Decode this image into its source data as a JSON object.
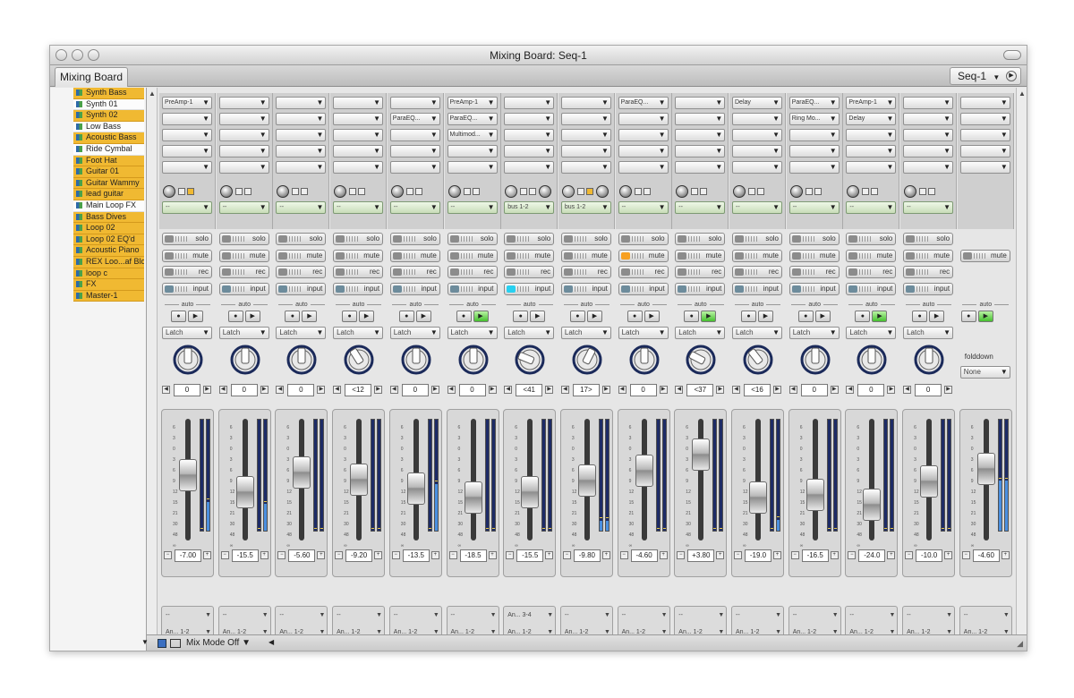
{
  "window": {
    "title": "Mixing Board: Seq-1",
    "tab": "Mixing Board",
    "sequence": "Seq-1"
  },
  "tracklist": [
    {
      "name": "Synth Bass",
      "selected": false
    },
    {
      "name": "Synth 01",
      "selected": true
    },
    {
      "name": "Synth 02",
      "selected": false
    },
    {
      "name": "Low Bass",
      "selected": true
    },
    {
      "name": "Acoustic Bass",
      "selected": false
    },
    {
      "name": "Ride Cymbal",
      "selected": true
    },
    {
      "name": "Foot Hat",
      "selected": false
    },
    {
      "name": "Guitar 01",
      "selected": false
    },
    {
      "name": "Guitar Wammy",
      "selected": false
    },
    {
      "name": "lead guitar",
      "selected": false
    },
    {
      "name": "Main Loop FX",
      "selected": true
    },
    {
      "name": "Bass Dives",
      "selected": false
    },
    {
      "name": "Loop 02",
      "selected": false
    },
    {
      "name": "Loop 02 EQ'd",
      "selected": false
    },
    {
      "name": "Acoustic Piano",
      "selected": false
    },
    {
      "name": "REX Loo...af Blower",
      "selected": false
    },
    {
      "name": "loop c",
      "selected": false
    },
    {
      "name": "FX",
      "selected": false
    },
    {
      "name": "Master-1",
      "selected": false
    }
  ],
  "labels": {
    "solo": "solo",
    "mute": "mute",
    "rec": "rec",
    "input": "input",
    "auto": "auto",
    "latch": "Latch",
    "folddown": "folddown",
    "none": "None",
    "mix_mode": "Mix Mode Off",
    "dash": "--",
    "dash_small": "--",
    "stop": "●",
    "play": "▶",
    "minus": "−",
    "plus": "+",
    "dd": "▼"
  },
  "channels": [
    {
      "name": "Synth Bass",
      "color": "#8e4f8f",
      "inserts": [
        "PreAmp-1",
        "",
        "",
        "",
        ""
      ],
      "bus": "",
      "pan_text": "0",
      "pan_pct": 0.5,
      "fader_text": "-7.00",
      "fader_pct": 0.55,
      "meter_pct": [
        0,
        0.26
      ],
      "out1": "--",
      "out2": "An... 1-2",
      "auto_on": false,
      "bus_type": "knob"
    },
    {
      "name": "Synth 02",
      "color": "#2e6e91",
      "inserts": [
        "",
        "",
        "",
        "",
        ""
      ],
      "bus": "",
      "pan_text": "0",
      "pan_pct": 0.5,
      "fader_text": "-15.5",
      "fader_pct": 0.36,
      "meter_pct": [
        0,
        0.24
      ],
      "out1": "--",
      "out2": "An... 1-2",
      "auto_on": false,
      "bus_type": "knob"
    },
    {
      "name": "Acoustic Bass",
      "color": "#2f8a8a",
      "inserts": [
        "",
        "",
        "",
        "",
        ""
      ],
      "bus": "",
      "pan_text": "0",
      "pan_pct": 0.5,
      "fader_text": "-5.60",
      "fader_pct": 0.58,
      "meter_pct": [
        0,
        0
      ],
      "out1": "--",
      "out2": "An... 1-2",
      "auto_on": false,
      "bus_type": "knob"
    },
    {
      "name": "Foot Hat",
      "color": "#555a8f",
      "inserts": [
        "",
        "",
        "",
        "",
        ""
      ],
      "bus": "",
      "pan_text": "<12",
      "pan_pct": 0.38,
      "fader_text": "-9.20",
      "fader_pct": 0.5,
      "meter_pct": [
        0,
        0
      ],
      "out1": "--",
      "out2": "An... 1-2",
      "auto_on": false,
      "bus_type": "knob"
    },
    {
      "name": "Guitar 01",
      "color": "#3e7b97",
      "inserts": [
        "",
        "ParaEQ...",
        "",
        "",
        ""
      ],
      "bus": "",
      "pan_text": "0",
      "pan_pct": 0.5,
      "fader_text": "-13.5",
      "fader_pct": 0.4,
      "meter_pct": [
        0,
        0.42
      ],
      "out1": "--",
      "out2": "An... 1-2",
      "auto_on": false,
      "bus_type": "knob"
    },
    {
      "name": "Guitar Wammy",
      "color": "#c0823e",
      "inserts": [
        "PreAmp-1",
        "ParaEQ...",
        "Multimod...",
        "",
        ""
      ],
      "bus": "",
      "pan_text": "0",
      "pan_pct": 0.5,
      "fader_text": "-18.5",
      "fader_pct": 0.3,
      "meter_pct": [
        0,
        0
      ],
      "out1": "--",
      "out2": "An... 1-2",
      "auto_on": true,
      "bus_type": "knob"
    },
    {
      "name": "lead guitar",
      "color": "#5c8a3c",
      "inserts": [
        "",
        "",
        "",
        "",
        ""
      ],
      "bus": "bus 1-2",
      "pan_text": "<41",
      "pan_pct": 0.25,
      "fader_text": "-15.5",
      "fader_pct": 0.36,
      "meter_pct": [
        0,
        0
      ],
      "out1": "An... 3-4",
      "out2": "An... 1-2",
      "auto_on": false,
      "bus_type": "send"
    },
    {
      "name": "Bass Dives",
      "color": "#7f7f7f",
      "inserts": [
        "",
        "",
        "",
        "",
        ""
      ],
      "bus": "bus 1-2",
      "pan_text": "17>",
      "pan_pct": 0.6,
      "fader_text": "-9.80",
      "fader_pct": 0.49,
      "meter_pct": [
        0.09,
        0.09
      ],
      "out1": "--",
      "out2": "An... 1-2",
      "auto_on": false,
      "bus_type": "send"
    },
    {
      "name": "Loop 02",
      "color": "#b0664a",
      "inserts": [
        "ParaEQ...",
        "",
        "",
        "",
        ""
      ],
      "bus": "",
      "pan_text": "0",
      "pan_pct": 0.5,
      "fader_text": "-4.60",
      "fader_pct": 0.6,
      "meter_pct": [
        0,
        0
      ],
      "out1": "--",
      "out2": "An... 1-2",
      "auto_on": false,
      "bus_type": "knob"
    },
    {
      "name": "Acoustic Piano",
      "color": "#3f8d6a",
      "inserts": [
        "",
        "",
        "",
        "",
        ""
      ],
      "bus": "",
      "pan_text": "<37",
      "pan_pct": 0.27,
      "fader_text": "+3.80",
      "fader_pct": 0.78,
      "meter_pct": [
        0,
        0
      ],
      "out1": "--",
      "out2": "An... 1-2",
      "auto_on": true,
      "bus_type": "knob"
    },
    {
      "name": "REX L... Blower",
      "color": "#3b4e8a",
      "inserts": [
        "Delay",
        "",
        "",
        "",
        ""
      ],
      "bus": "",
      "pan_text": "<16",
      "pan_pct": 0.36,
      "fader_text": "-19.0",
      "fader_pct": 0.3,
      "meter_pct": [
        0,
        0.1
      ],
      "out1": "--",
      "out2": "An... 1-2",
      "auto_on": false,
      "bus_type": "knob"
    },
    {
      "name": "Loop 02 EQ'd",
      "color": "#2a6a9f",
      "inserts": [
        "ParaEQ...",
        "Ring Mo...",
        "",
        "",
        ""
      ],
      "bus": "",
      "pan_text": "0",
      "pan_pct": 0.5,
      "fader_text": "-16.5",
      "fader_pct": 0.33,
      "meter_pct": [
        0,
        0
      ],
      "out1": "--",
      "out2": "An... 1-2",
      "auto_on": false,
      "bus_type": "knob"
    },
    {
      "name": "FX",
      "color": "#4f7fb5",
      "inserts": [
        "PreAmp-1",
        "Delay",
        "",
        "",
        ""
      ],
      "bus": "",
      "pan_text": "0",
      "pan_pct": 0.5,
      "fader_text": "-24.0",
      "fader_pct": 0.22,
      "meter_pct": [
        0,
        0
      ],
      "out1": "--",
      "out2": "An... 1-2",
      "auto_on": true,
      "bus_type": "knob"
    },
    {
      "name": "loop c",
      "color": "#5a7f5a",
      "inserts": [
        "",
        "",
        "",
        "",
        ""
      ],
      "bus": "",
      "pan_text": "0",
      "pan_pct": 0.5,
      "fader_text": "-10.0",
      "fader_pct": 0.48,
      "meter_pct": [
        0,
        0
      ],
      "out1": "--",
      "out2": "An... 1-2",
      "auto_on": false,
      "bus_type": "knob"
    },
    {
      "name": "Master-1",
      "color": "#b96a5c",
      "inserts": [
        "",
        "",
        "",
        "",
        ""
      ],
      "bus": "",
      "pan_text": "",
      "pan_pct": 0.5,
      "fader_text": "-4.60",
      "fader_pct": 0.62,
      "meter_pct": [
        0.45,
        0.45
      ],
      "out1": "--",
      "out2": "An... 1-2",
      "auto_on": true,
      "bus_type": "master"
    }
  ],
  "colors": {
    "track_bg": "#f0b932",
    "mute_active": "#f7a020",
    "input_active": "#27d0f0",
    "meter_fill": "#4a8fe0",
    "knob_ring": "#1b2a5a"
  },
  "fader_scale": [
    "6",
    "3",
    "0",
    "3",
    "6",
    "9",
    "12",
    "15",
    "21",
    "30",
    "48",
    "∞"
  ]
}
